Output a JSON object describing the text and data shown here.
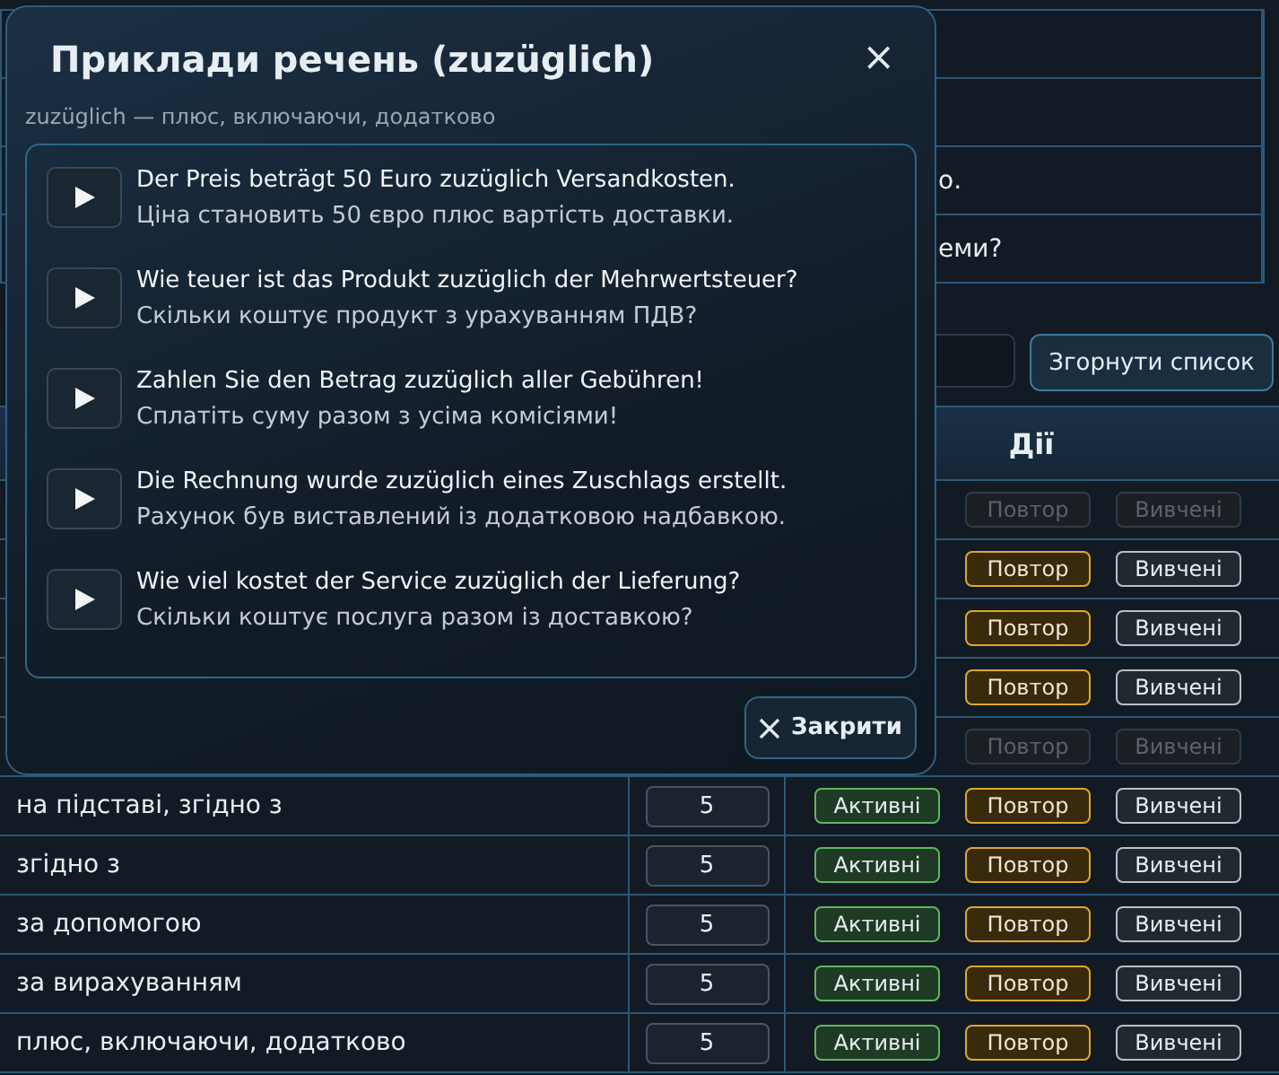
{
  "background_list": {
    "rows": [
      {},
      {},
      {
        "text": "о."
      },
      {
        "text": "еми?"
      }
    ]
  },
  "collapse_button": {
    "label": "Згорнути список"
  },
  "table": {
    "columns": [
      {
        "label": "Дії"
      }
    ],
    "rows": [
      {
        "repeat": {
          "label": "Повтор",
          "disabled": true
        },
        "learned": {
          "label": "Вивчені",
          "disabled": true
        }
      },
      {
        "repeat": {
          "label": "Повтор",
          "disabled": false
        },
        "learned": {
          "label": "Вивчені",
          "disabled": false
        }
      },
      {
        "repeat": {
          "label": "Повтор",
          "disabled": false
        },
        "learned": {
          "label": "Вивчені",
          "disabled": false
        }
      },
      {
        "repeat": {
          "label": "Повтор",
          "disabled": false
        },
        "learned": {
          "label": "Вивчені",
          "disabled": false
        }
      },
      {
        "repeat": {
          "label": "Повтор",
          "disabled": true
        },
        "learned": {
          "label": "Вивчені",
          "disabled": true
        }
      },
      {
        "word": "на підставі, згідно з",
        "count": "5",
        "active": {
          "label": "Активні"
        },
        "repeat": {
          "label": "Повтор",
          "disabled": false
        },
        "learned": {
          "label": "Вивчені",
          "disabled": false
        }
      },
      {
        "word": "згідно з",
        "count": "5",
        "active": {
          "label": "Активні"
        },
        "repeat": {
          "label": "Повтор",
          "disabled": false
        },
        "learned": {
          "label": "Вивчені",
          "disabled": false
        }
      },
      {
        "word": "за допомогою",
        "count": "5",
        "active": {
          "label": "Активні"
        },
        "repeat": {
          "label": "Повтор",
          "disabled": false
        },
        "learned": {
          "label": "Вивчені",
          "disabled": false
        }
      },
      {
        "word": "за вирахуванням",
        "count": "5",
        "active": {
          "label": "Активні"
        },
        "repeat": {
          "label": "Повтор",
          "disabled": false
        },
        "learned": {
          "label": "Вивчені",
          "disabled": false
        }
      },
      {
        "word": "плюс, включаючи, додатково",
        "count": "5",
        "active": {
          "label": "Активні"
        },
        "repeat": {
          "label": "Повтор",
          "disabled": false
        },
        "learned": {
          "label": "Вивчені",
          "disabled": false
        }
      }
    ]
  },
  "dialog": {
    "title": "Приклади речень (zuzüglich)",
    "close_icon": "×",
    "subtitle": "zuzüglich — плюс, включаючи, додатково",
    "examples": [
      {
        "german": "Der Preis beträgt 50 Euro zuzüglich Versandkosten.",
        "translation": "Ціна становить 50 євро плюс вартість доставки."
      },
      {
        "german": "Wie teuer ist das Produkt zuzüglich der Mehrwertsteuer?",
        "translation": "Скільки коштує продукт з урахуванням ПДВ?"
      },
      {
        "german": "Zahlen Sie den Betrag zuzüglich aller Gebühren!",
        "translation": "Сплатіть суму разом з усіма комісіями!"
      },
      {
        "german": "Die Rechnung wurde zuzüglich eines Zuschlags erstellt.",
        "translation": "Рахунок був виставлений із додатковою надбавкою."
      },
      {
        "german": "Wie viel kostet der Service zuzüglich der Lieferung?",
        "translation": "Скільки коштує послуга разом із доставкою?"
      }
    ],
    "close_button": {
      "label": "Закрити"
    }
  }
}
